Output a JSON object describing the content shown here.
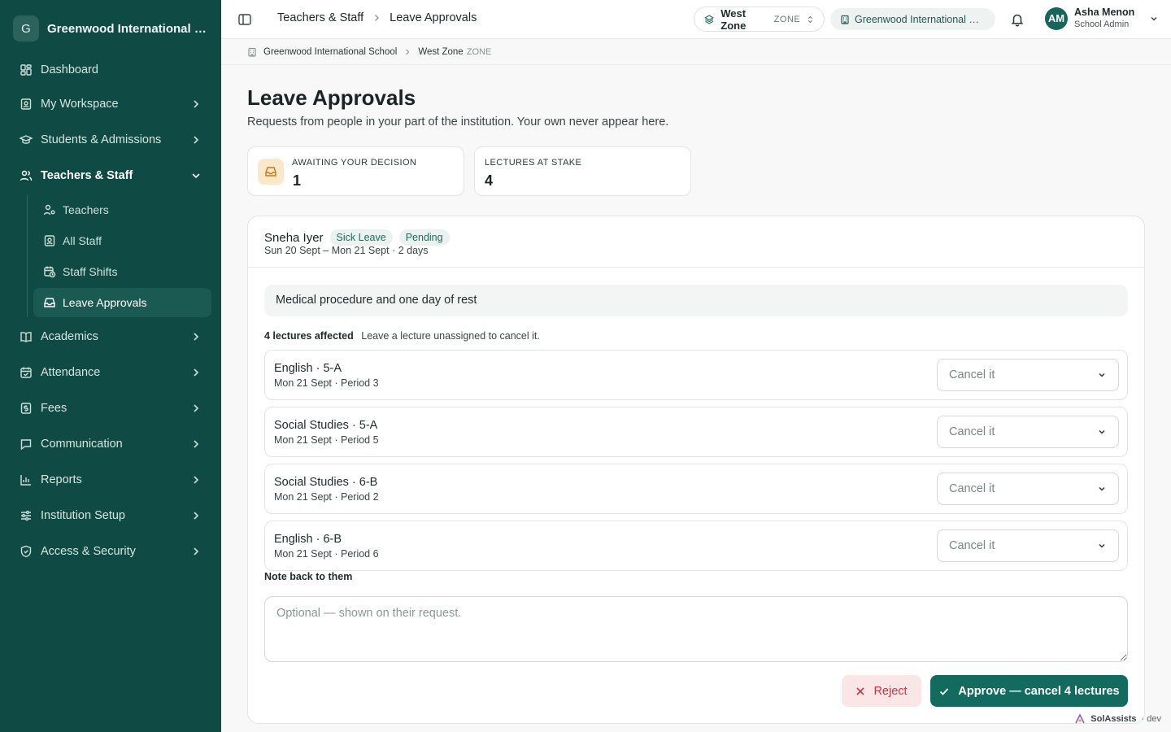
{
  "sidebar": {
    "org_initial": "G",
    "org_name": "Greenwood International School",
    "items": [
      {
        "label": "Dashboard",
        "icon": "dashboard-icon"
      },
      {
        "label": "My Workspace",
        "icon": "id-badge-icon"
      },
      {
        "label": "Students & Admissions",
        "icon": "graduation-cap-icon"
      },
      {
        "label": "Teachers & Staff",
        "icon": "users-icon"
      },
      {
        "label": "Academics",
        "icon": "book-icon"
      },
      {
        "label": "Attendance",
        "icon": "calendar-check-icon"
      },
      {
        "label": "Fees",
        "icon": "receipt-icon"
      },
      {
        "label": "Communication",
        "icon": "chat-icon"
      },
      {
        "label": "Reports",
        "icon": "bar-chart-icon"
      },
      {
        "label": "Institution Setup",
        "icon": "sliders-icon"
      },
      {
        "label": "Access & Security",
        "icon": "shield-icon"
      }
    ],
    "subitems": [
      {
        "label": "Teachers",
        "icon": "user-gear-icon"
      },
      {
        "label": "All Staff",
        "icon": "id-badge-icon"
      },
      {
        "label": "Staff Shifts",
        "icon": "calendar-clock-icon"
      },
      {
        "label": "Leave Approvals",
        "icon": "inbox-icon"
      }
    ]
  },
  "topbar": {
    "breadcrumb": [
      "Teachers & Staff",
      "Leave Approvals"
    ],
    "zone_name": "West Zone",
    "zone_tag": "ZONE",
    "school": "Greenwood International School",
    "user_initials": "AM",
    "user_name": "Asha Menon",
    "user_role": "School Admin"
  },
  "subcrumb": {
    "school": "Greenwood International School",
    "zone": "West Zone",
    "zone_tag": "ZONE"
  },
  "page": {
    "title": "Leave Approvals",
    "subtitle": "Requests from people in your part of the institution. Your own never appear here."
  },
  "stats": [
    {
      "label": "AWAITING YOUR DECISION",
      "value": "1"
    },
    {
      "label": "LECTURES AT STAKE",
      "value": "4"
    }
  ],
  "request": {
    "name": "Sneha Iyer",
    "type": "Sick Leave",
    "status": "Pending",
    "dates": "Sun 20 Sept – Mon 21 Sept · 2 days",
    "reason": "Medical procedure and one day of rest",
    "affected_count": "4 lectures affected",
    "affected_hint": "Leave a lecture unassigned to cancel it.",
    "lectures": [
      {
        "name": "English · 5-A",
        "slot": "Mon 21 Sept · Period 3",
        "choice": "Cancel it"
      },
      {
        "name": "Social Studies · 5-A",
        "slot": "Mon 21 Sept · Period 5",
        "choice": "Cancel it"
      },
      {
        "name": "Social Studies · 6-B",
        "slot": "Mon 21 Sept · Period 2",
        "choice": "Cancel it"
      },
      {
        "name": "English · 6-B",
        "slot": "Mon 21 Sept · Period 6",
        "choice": "Cancel it"
      }
    ],
    "note_label": "Note back to them",
    "note_placeholder": "Optional — shown on their request.",
    "reject_label": "Reject",
    "approve_label": "Approve — cancel 4 lectures"
  },
  "footer": {
    "brand": "SolAssists",
    "env": "· dev"
  },
  "colors": {
    "sidebar": "#0f4a44",
    "accent": "#126b5e",
    "danger": "#c73845"
  }
}
